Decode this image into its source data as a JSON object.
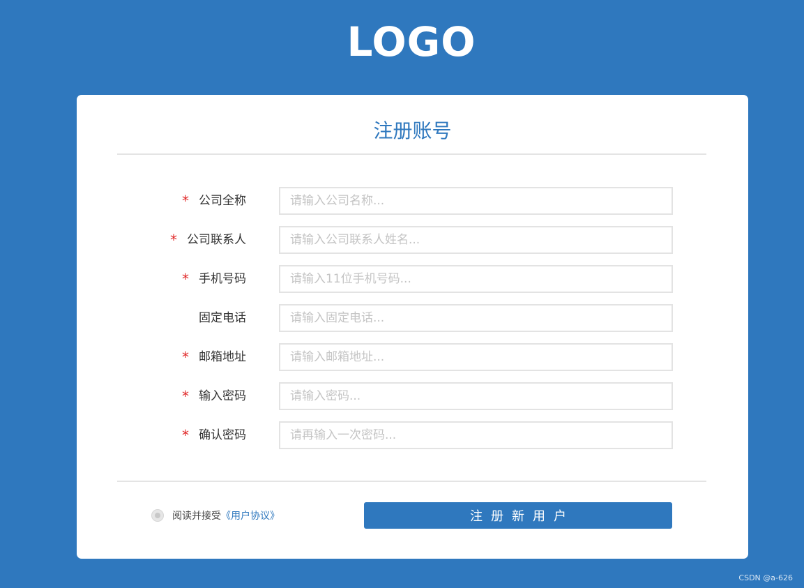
{
  "logo": {
    "text": "LOGO"
  },
  "form": {
    "title": "注册账号",
    "required_mark": "*",
    "fields": [
      {
        "label": "公司全称",
        "required": true,
        "placeholder": "请输入公司名称...",
        "value": ""
      },
      {
        "label": "公司联系人",
        "required": true,
        "placeholder": "请输入公司联系人姓名...",
        "value": ""
      },
      {
        "label": "手机号码",
        "required": true,
        "placeholder": "请输入11位手机号码...",
        "value": ""
      },
      {
        "label": "固定电话",
        "required": false,
        "placeholder": "请输入固定电话...",
        "value": ""
      },
      {
        "label": "邮箱地址",
        "required": true,
        "placeholder": "请输入邮箱地址...",
        "value": ""
      },
      {
        "label": "输入密码",
        "required": true,
        "placeholder": "请输入密码...",
        "value": ""
      },
      {
        "label": "确认密码",
        "required": true,
        "placeholder": "请再输入一次密码...",
        "value": ""
      }
    ],
    "agreement": {
      "text": "阅读并接受",
      "link": "《用户协议》",
      "checked": false
    },
    "submit_label": "注册新用户"
  },
  "watermark": "CSDN @a-626",
  "colors": {
    "background": "#2f78be",
    "accent": "#2f78be",
    "required": "#e02828",
    "card": "#ffffff"
  }
}
